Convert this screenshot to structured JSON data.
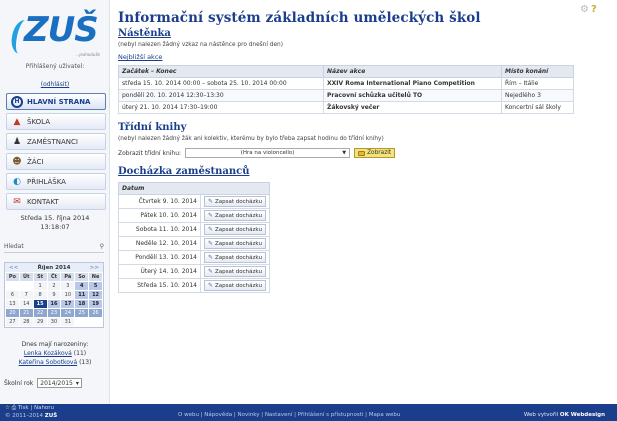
{
  "brand": {
    "logo_text": "ZUŠ",
    "logo_sub": "...jednoduše"
  },
  "sidebar": {
    "login_label": "Přihlášený uživatel:",
    "login_link": "(odhlásit)",
    "menu": [
      {
        "label": "HLAVNÍ STRANA",
        "icon": "home-icon"
      },
      {
        "label": "ŠKOLA",
        "icon": "school-icon"
      },
      {
        "label": "ZAMĚSTNANCI",
        "icon": "employees-icon"
      },
      {
        "label": "ŽÁCI",
        "icon": "students-icon"
      },
      {
        "label": "PŘIHLÁŠKA",
        "icon": "registration-icon"
      },
      {
        "label": "KONTAKT",
        "icon": "contact-icon"
      }
    ],
    "date_line": "Středa 15. října 2014",
    "time_line": "13:18:07",
    "search_label": "Hledat",
    "calendar": {
      "prev": "<<",
      "next": ">>",
      "month": "Říjen 2014",
      "day_names": [
        "Po",
        "Út",
        "St",
        "Čt",
        "Pá",
        "So",
        "Ne"
      ],
      "weeks": [
        [
          "",
          "",
          "1",
          "2",
          "3",
          "4",
          "5"
        ],
        [
          "6",
          "7",
          "8",
          "9",
          "10",
          "11",
          "12"
        ],
        [
          "13",
          "14",
          "15",
          "16",
          "17",
          "18",
          "19"
        ],
        [
          "20",
          "21",
          "22",
          "23",
          "24",
          "25",
          "26"
        ],
        [
          "27",
          "28",
          "29",
          "30",
          "31",
          "",
          ""
        ]
      ],
      "today": "15"
    },
    "birthday_title": "Dnes mají narozeniny:",
    "birthdays": [
      {
        "name": "Lenka Kozáková",
        "count": "(11)"
      },
      {
        "name": "Kateřina Sobotková",
        "count": "(13)"
      }
    ],
    "school_year_label": "Školní rok",
    "school_year_value": "2014/2015"
  },
  "main": {
    "title": "Informační systém základních uměleckých škol",
    "board_heading": "Nástěnka",
    "board_note": "(nebyl nalezen žádný vzkaz na nástěnce pro dnešní den)",
    "events_link": "Nejbližší akce",
    "events_headers": [
      "Začátek – Konec",
      "Název akce",
      "Místo konání"
    ],
    "events": [
      {
        "when": "středa 15. 10. 2014 00:00 – sobota 25. 10. 2014 00:00",
        "name": "XXIV Roma International Piano Competition",
        "place": "Řím – Itálie"
      },
      {
        "when": "pondělí 20. 10. 2014 12:30–13:30",
        "name": "Pracovní schůzka učitelů TO",
        "place": "Nejedlého 3"
      },
      {
        "when": "úterý 21. 10. 2014 17:30–19:00",
        "name": "Žákovský večer",
        "place": "Koncertní sál školy"
      }
    ],
    "class_books_heading": "Třídní knihy",
    "class_books_note": "(nebyl nalezen žádný žák ani kolektiv, kterému by bylo třeba zapsat hodinu do třídní knihy)",
    "show_book_label": "Zobrazit třídní knihu:",
    "book_select_value": "(Hra na violoncello)",
    "show_button": "Zobrazit",
    "attendance_heading": "Docházka zaměstnanců",
    "attendance_header": "Datum",
    "attendance_button": "Zapsat docházku",
    "attendance": [
      "Čtvrtek 9. 10. 2014",
      "Pátek 10. 10. 2014",
      "Sobota 11. 10. 2014",
      "Neděle 12. 10. 2014",
      "Pondělí 13. 10. 2014",
      "Úterý 14. 10. 2014",
      "Středa 15. 10. 2014"
    ]
  },
  "footer": {
    "tools": "Tisk | Nahoru",
    "copyright": "© 2011–2014",
    "copyright_brand": "ZUŠ",
    "links": "O webu | Nápověda | Novinky | Nastavení | Přihlášení s přístupnosti | Mapa webu",
    "credit_prefix": "Web vytvořil",
    "credit_name": "OK Webdesign"
  },
  "colors": {
    "primary": "#1a3e8c",
    "accent": "#1b6fc0",
    "button_yellow": "#f5e27a"
  }
}
